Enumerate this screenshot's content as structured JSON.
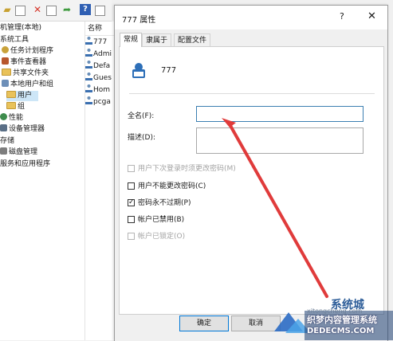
{
  "mmc": {
    "tree": [
      "机管理(本地)",
      "系统工具",
      "任务计划程序",
      "事件查看器",
      "共享文件夹",
      "本地用户和组",
      "用户",
      "组",
      "性能",
      "设备管理器",
      "存储",
      "磁盘管理",
      "服务和应用程序"
    ],
    "list_header": "名称",
    "list_items": [
      "777",
      "Admi",
      "Defa",
      "Gues",
      "Hom",
      "pcga"
    ]
  },
  "dialog": {
    "title": "777 属性",
    "help": "?",
    "close": "✕",
    "tabs": [
      "常规",
      "隶属于",
      "配置文件"
    ],
    "username": "777",
    "fullname_label": "全名(F):",
    "fullname_value": "",
    "description_label": "描述(D):",
    "description_value": "",
    "checkboxes": [
      {
        "label": "用户下次登录时须更改密码(M)",
        "checked": false,
        "disabled": true
      },
      {
        "label": "用户不能更改密码(C)",
        "checked": false,
        "disabled": false
      },
      {
        "label": "密码永不过期(P)",
        "checked": true,
        "disabled": false
      },
      {
        "label": "帐户已禁用(B)",
        "checked": false,
        "disabled": false
      },
      {
        "label": "帐户已锁定(O)",
        "checked": false,
        "disabled": true
      }
    ],
    "ok": "确定",
    "cancel": "取消"
  },
  "watermark": {
    "site": "系统城",
    "small": "xitongcheng.com",
    "cms": "织梦内容管理系统",
    "domain": "DEDECMS.COM"
  },
  "colors": {
    "arrow": "#e03b3b",
    "accent": "#0078d7"
  }
}
